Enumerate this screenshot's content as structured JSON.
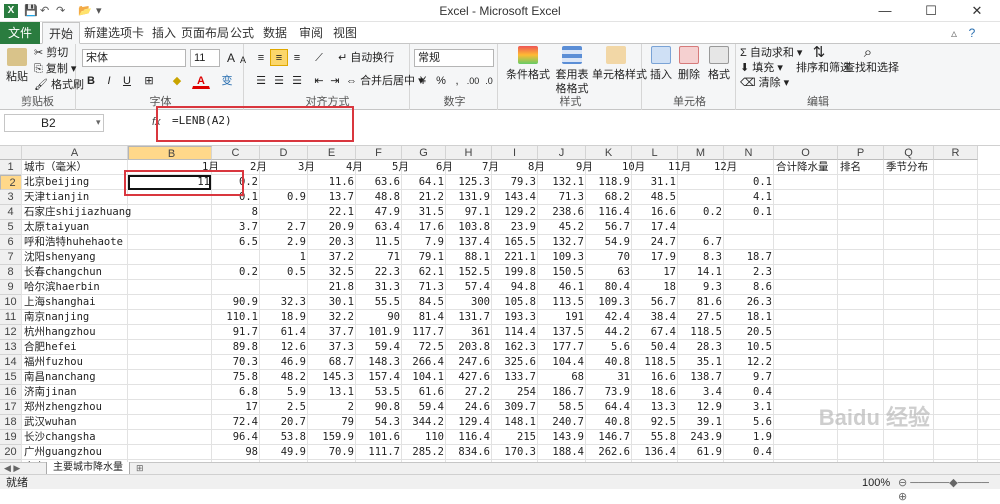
{
  "window": {
    "title": "Excel - Microsoft Excel"
  },
  "tabs": [
    {
      "label": "文件"
    },
    {
      "label": "开始"
    },
    {
      "label": "新建选项卡"
    },
    {
      "label": "插入"
    },
    {
      "label": "页面布局"
    },
    {
      "label": "公式"
    },
    {
      "label": "数据"
    },
    {
      "label": "审阅"
    },
    {
      "label": "视图"
    }
  ],
  "ribbon": {
    "clipboard": {
      "label": "剪贴板",
      "paste": "粘贴",
      "cut": "剪切",
      "copy": "复制",
      "format_painter": "格式刷"
    },
    "font": {
      "label": "字体",
      "name": "宋体",
      "size": "11",
      "bold": "B",
      "italic": "I",
      "underline": "U",
      "grow": "A",
      "shrink": "A",
      "font_color": "A",
      "phonetic": "变"
    },
    "alignment": {
      "label": "对齐方式",
      "wrap": "自动换行",
      "merge": "合并后居中"
    },
    "number": {
      "label": "数字",
      "format": "常规",
      "percent": "%",
      "comma": ",",
      "increase_decimal": ".00",
      "decrease_decimal": ".0"
    },
    "styles": {
      "label": "样式",
      "conditional": "条件格式",
      "table": "套用表格格式",
      "cell_styles": "单元格样式"
    },
    "cells": {
      "label": "单元格",
      "insert": "插入",
      "delete": "删除",
      "format": "格式"
    },
    "editing": {
      "label": "编辑",
      "autosum": "自动求和",
      "fill": "填充",
      "clear": "清除",
      "sort_filter": "排序和筛选",
      "find_select": "查找和选择"
    }
  },
  "formula_bar": {
    "name_box": "B2",
    "fx": "fx",
    "formula": "=LENB(A2)"
  },
  "columns": [
    "A",
    "B",
    "C",
    "D",
    "E",
    "F",
    "G",
    "H",
    "I",
    "J",
    "K",
    "L",
    "M",
    "N",
    "O",
    "P",
    "Q",
    "R"
  ],
  "header_row": [
    "城市（毫米）",
    "",
    "1月",
    "2月",
    "3月",
    "4月",
    "5月",
    "6月",
    "7月",
    "8月",
    "9月",
    "10月",
    "11月",
    "12月",
    "合计降水量",
    "排名",
    "季节分布"
  ],
  "rows": [
    [
      "北京beijing",
      "11",
      "0.2",
      "",
      "11.6",
      "63.6",
      "64.1",
      "125.3",
      "79.3",
      "132.1",
      "118.9",
      "31.1",
      "",
      "0.1"
    ],
    [
      "天津tianjin",
      "",
      "0.1",
      "0.9",
      "13.7",
      "48.8",
      "21.2",
      "131.9",
      "143.4",
      "71.3",
      "68.2",
      "48.5",
      "",
      "4.1"
    ],
    [
      "石家庄shijiazhuang",
      "",
      "8",
      "",
      "22.1",
      "47.9",
      "31.5",
      "97.1",
      "129.2",
      "238.6",
      "116.4",
      "16.6",
      "0.2",
      "0.1"
    ],
    [
      "太原taiyuan",
      "",
      "3.7",
      "2.7",
      "20.9",
      "63.4",
      "17.6",
      "103.8",
      "23.9",
      "45.2",
      "56.7",
      "17.4",
      "",
      ""
    ],
    [
      "呼和浩特huhehaote",
      "",
      "6.5",
      "2.9",
      "20.3",
      "11.5",
      "7.9",
      "137.4",
      "165.5",
      "132.7",
      "54.9",
      "24.7",
      "6.7",
      ""
    ],
    [
      "沈阳shenyang",
      "",
      "",
      "1",
      "37.2",
      "71",
      "79.1",
      "88.1",
      "221.1",
      "109.3",
      "70",
      "17.9",
      "8.3",
      "18.7"
    ],
    [
      "长春changchun",
      "",
      "0.2",
      "0.5",
      "32.5",
      "22.3",
      "62.1",
      "152.5",
      "199.8",
      "150.5",
      "63",
      "17",
      "14.1",
      "2.3"
    ],
    [
      "哈尔滨haerbin",
      "",
      "",
      "",
      "21.8",
      "31.3",
      "71.3",
      "57.4",
      "94.8",
      "46.1",
      "80.4",
      "18",
      "9.3",
      "8.6"
    ],
    [
      "上海shanghai",
      "",
      "90.9",
      "32.3",
      "30.1",
      "55.5",
      "84.5",
      "300",
      "105.8",
      "113.5",
      "109.3",
      "56.7",
      "81.6",
      "26.3"
    ],
    [
      "南京nanjing",
      "",
      "110.1",
      "18.9",
      "32.2",
      "90",
      "81.4",
      "131.7",
      "193.3",
      "191",
      "42.4",
      "38.4",
      "27.5",
      "18.1"
    ],
    [
      "杭州hangzhou",
      "",
      "91.7",
      "61.4",
      "37.7",
      "101.9",
      "117.7",
      "361",
      "114.4",
      "137.5",
      "44.2",
      "67.4",
      "118.5",
      "20.5"
    ],
    [
      "合肥hefei",
      "",
      "89.8",
      "12.6",
      "37.3",
      "59.4",
      "72.5",
      "203.8",
      "162.3",
      "177.7",
      "5.6",
      "50.4",
      "28.3",
      "10.5"
    ],
    [
      "福州fuzhou",
      "",
      "70.3",
      "46.9",
      "68.7",
      "148.3",
      "266.4",
      "247.6",
      "325.6",
      "104.4",
      "40.8",
      "118.5",
      "35.1",
      "12.2"
    ],
    [
      "南昌nanchang",
      "",
      "75.8",
      "48.2",
      "145.3",
      "157.4",
      "104.1",
      "427.6",
      "133.7",
      "68",
      "31",
      "16.6",
      "138.7",
      "9.7"
    ],
    [
      "济南jinan",
      "",
      "6.8",
      "5.9",
      "13.1",
      "53.5",
      "61.6",
      "27.2",
      "254",
      "186.7",
      "73.9",
      "18.6",
      "3.4",
      "0.4"
    ],
    [
      "郑州zhengzhou",
      "",
      "17",
      "2.5",
      "2",
      "90.8",
      "59.4",
      "24.6",
      "309.7",
      "58.5",
      "64.4",
      "13.3",
      "12.9",
      "3.1"
    ],
    [
      "武汉wuhan",
      "",
      "72.4",
      "20.7",
      "79",
      "54.3",
      "344.2",
      "129.4",
      "148.1",
      "240.7",
      "40.8",
      "92.5",
      "39.1",
      "5.6"
    ],
    [
      "长沙changsha",
      "",
      "96.4",
      "53.8",
      "159.9",
      "101.6",
      "110",
      "116.4",
      "215",
      "143.9",
      "146.7",
      "55.8",
      "243.9",
      "1.9"
    ],
    [
      "广州guangzhou",
      "",
      "98",
      "49.9",
      "70.9",
      "111.7",
      "285.2",
      "834.6",
      "170.3",
      "188.4",
      "262.6",
      "136.4",
      "61.9",
      "0.4"
    ],
    [
      "南宁nanning",
      "",
      "76.1",
      "70",
      "18.7",
      "45.2",
      "121.8",
      "300.6",
      "260.1",
      "317.4",
      "187.6",
      "47.6",
      "156",
      "23.9"
    ]
  ],
  "sheet_tab": "主要城市降水量",
  "status": {
    "ready": "就绪",
    "zoom": "100%"
  },
  "watermark": "Baidu 经验"
}
